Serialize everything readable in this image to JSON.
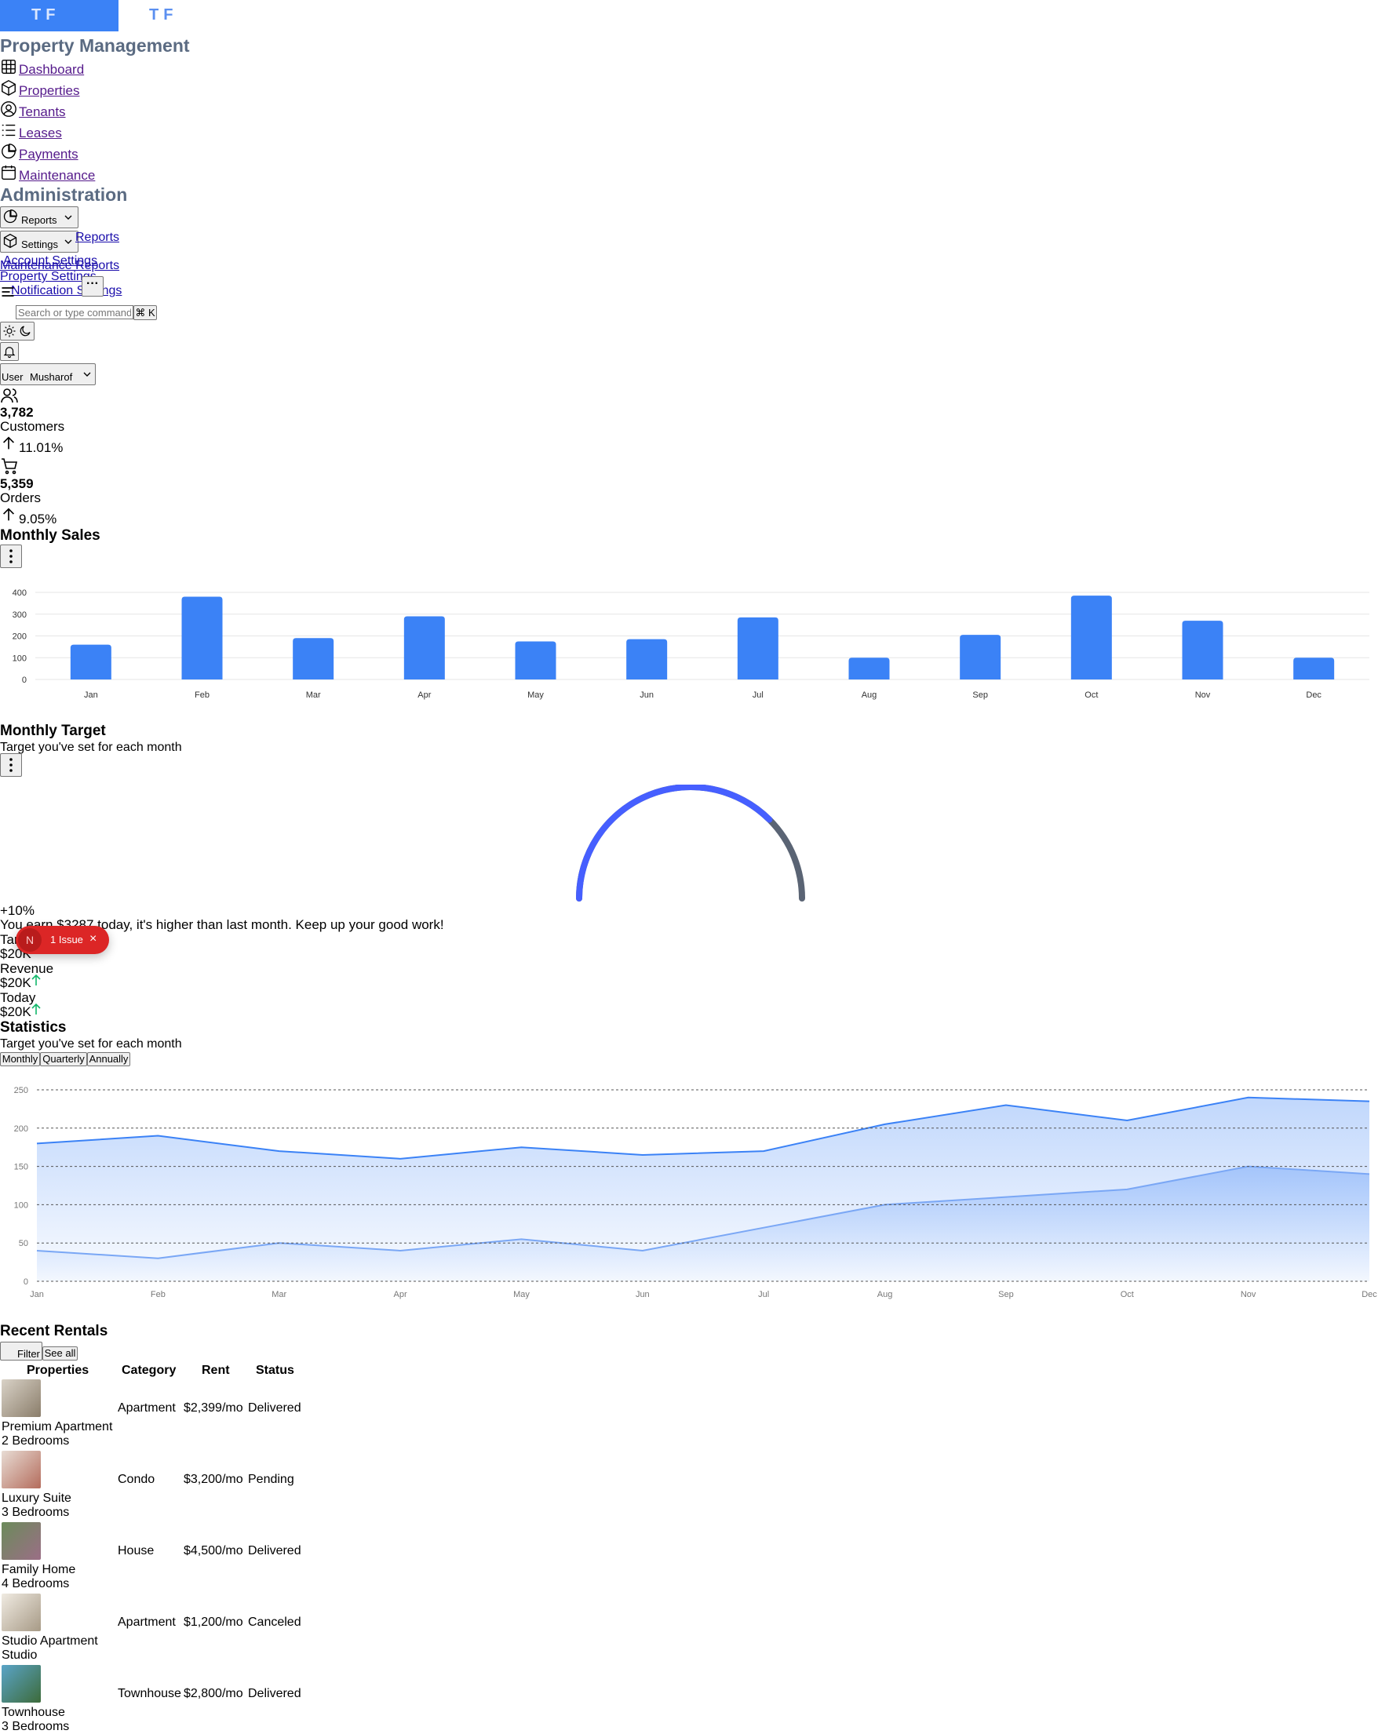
{
  "logo": {
    "text": "TF",
    "text_dark": "TF"
  },
  "nav": {
    "section_title": "Property Management",
    "items": [
      {
        "label": "Dashboard",
        "icon": "grid-icon"
      },
      {
        "label": "Properties",
        "icon": "box-icon"
      },
      {
        "label": "Tenants",
        "icon": "user-circle-icon"
      },
      {
        "label": "Leases",
        "icon": "list-icon"
      },
      {
        "label": "Payments",
        "icon": "pie-icon"
      },
      {
        "label": "Maintenance",
        "icon": "calendar-icon"
      }
    ],
    "admin_title": "Administration",
    "reports_label": "Reports",
    "settings_label": "Settings",
    "overlap_links": [
      "Reports",
      "Account Settings",
      "Maintenance Reports",
      "Property Settings",
      "Notification Settings"
    ]
  },
  "header": {
    "more_label": "···",
    "search_placeholder": "Search or type command...",
    "shortcut": "⌘ K",
    "user_label": "Musharof",
    "user_alt": "User"
  },
  "metrics": [
    {
      "value": "3,782",
      "label": "Customers",
      "change": "11.01%"
    },
    {
      "value": "5,359",
      "label": "Orders",
      "change": "9.05%"
    }
  ],
  "monthly_sales": {
    "title": "Monthly Sales"
  },
  "monthly_target": {
    "title": "Monthly Target",
    "subtitle": "Target you've set for each month",
    "percent": 0.75,
    "change": "+10%",
    "message": "You earn $3287 today, it's higher than last month. Keep up your good work!",
    "target_label": "Target",
    "target_value": "$20K",
    "revenue_label": "Revenue",
    "revenue_value": "$20K",
    "today_label": "Today",
    "today_value": "$20K"
  },
  "issue": {
    "initial": "N",
    "label": "1 Issue",
    "close": "×"
  },
  "statistics": {
    "title": "Statistics",
    "subtitle": "Target you've set for each month",
    "tabs": [
      "Monthly",
      "Quarterly",
      "Annually"
    ]
  },
  "rentals": {
    "title": "Recent Rentals",
    "filter_label": "Filter",
    "see_all_label": "See all",
    "headers": [
      "Properties",
      "Category",
      "Rent",
      "Status"
    ],
    "rows": [
      {
        "name": "Premium Apartment",
        "sub": "2 Bedrooms",
        "category": "Apartment",
        "rent": "$2,399/mo",
        "status": "Delivered"
      },
      {
        "name": "Luxury Suite",
        "sub": "3 Bedrooms",
        "category": "Condo",
        "rent": "$3,200/mo",
        "status": "Pending"
      },
      {
        "name": "Family Home",
        "sub": "4 Bedrooms",
        "category": "House",
        "rent": "$4,500/mo",
        "status": "Delivered"
      },
      {
        "name": "Studio Apartment",
        "sub": "Studio",
        "category": "Apartment",
        "rent": "$1,200/mo",
        "status": "Canceled"
      },
      {
        "name": "Townhouse",
        "sub": "3 Bedrooms",
        "category": "Townhouse",
        "rent": "$2,800/mo",
        "status": "Delivered"
      }
    ]
  },
  "colors": {
    "accent": "#3b82f6",
    "gauge": "#465fff",
    "gauge_track": "#5a6474",
    "up": "#12b76a"
  },
  "chart_data": [
    {
      "type": "bar",
      "categories": [
        "Jan",
        "Feb",
        "Mar",
        "Apr",
        "May",
        "Jun",
        "Jul",
        "Aug",
        "Sep",
        "Oct",
        "Nov",
        "Dec"
      ],
      "values": [
        160,
        380,
        190,
        290,
        175,
        185,
        285,
        100,
        205,
        385,
        270,
        100
      ],
      "yticks": [
        0,
        100,
        200,
        300,
        400
      ],
      "ylim": [
        0,
        400
      ],
      "grid": true
    },
    {
      "type": "area",
      "categories": [
        "Jan",
        "Feb",
        "Mar",
        "Apr",
        "May",
        "Jun",
        "Jul",
        "Aug",
        "Sep",
        "Oct",
        "Nov",
        "Dec"
      ],
      "series": [
        {
          "values": [
            180,
            190,
            170,
            160,
            175,
            165,
            170,
            205,
            230,
            210,
            240,
            235
          ]
        },
        {
          "values": [
            40,
            30,
            50,
            40,
            55,
            40,
            70,
            100,
            110,
            120,
            150,
            140
          ]
        }
      ],
      "yticks": [
        0,
        50,
        100,
        150,
        200,
        250
      ],
      "ylim": [
        0,
        250
      ],
      "grid": true
    }
  ]
}
